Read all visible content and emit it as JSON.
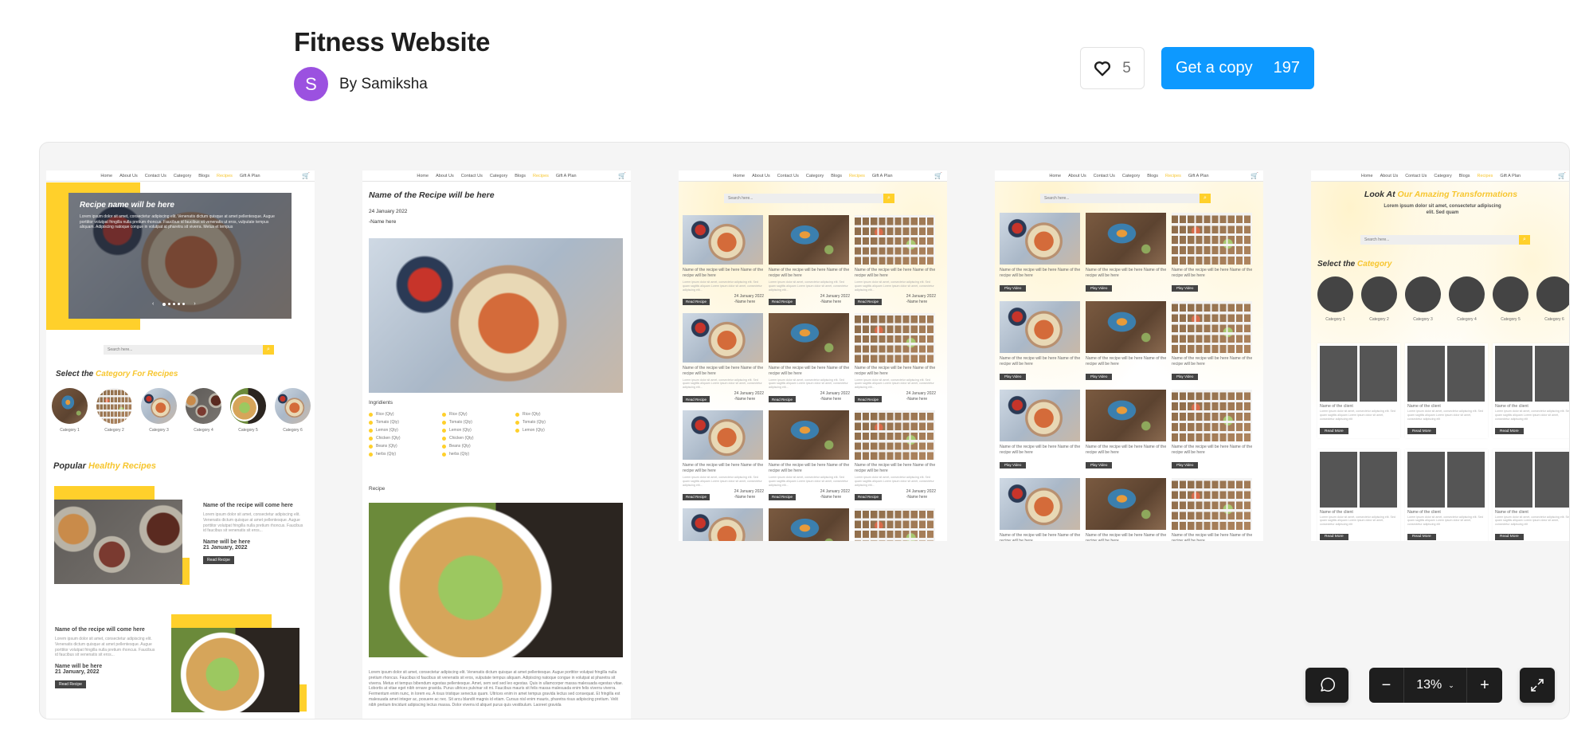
{
  "header": {
    "title": "Fitness Website",
    "author_initial": "S",
    "author_label": "By Samiksha",
    "avatar_color": "#9b51e0",
    "like_count": "5",
    "copy_label": "Get a copy",
    "copy_count": "197",
    "accent_color": "#0d99ff"
  },
  "nav": {
    "items": [
      "Home",
      "About Us",
      "Contact Us",
      "Category",
      "Blogs",
      "Recipes",
      "Gift A Plan"
    ],
    "active": "Recipes"
  },
  "search_placeholder": "Search here...",
  "frame1": {
    "hero_title": "Recipe name will be here",
    "hero_text": "Lorem ipsum dolor sit amet, consectetur adipiscing elit. Venenatis dictum quisque at amet pellentesque. Augue porttitor volutpat fringilla nulla pretium rhoncus. Faucibus id faucibus sit venenatis ut eros, vulputate tempus aliquam. Adipiscing natoque congue in volutpat at pharetra sit viverra. Metus et tempus",
    "category_heading_a": "Select the ",
    "category_heading_b": "Category For Recipes",
    "categories": [
      "Category 1",
      "Category 2",
      "Category 3",
      "Category 4",
      "Category 5",
      "Category 6"
    ],
    "popular_heading_a": "Popular ",
    "popular_heading_b": "Healthy Recipes",
    "popular": [
      {
        "title": "Name of the recipe will come here",
        "text": "Lorem ipsum dolor sit amet, consectetur adipiscing elit. Venenatis dictum quisque at amet pellentesque. Augue porttitor volutpat fringilla nulla pretium rhoncus. Faucibus id faucibus sit venenatis sit eros...",
        "author": "Name will be here",
        "date": "21 January, 2022",
        "button": "Read Recipe"
      },
      {
        "title": "Name of the recipe will come here",
        "text": "Lorem ipsum dolor sit amet, consectetur adipiscing elit. Venenatis dictum quisque at amet pellentesque. Augue porttitor volutpat fringilla nulla pretium rhoncus. Faucibus id faucibus sit venenatis sit eros...",
        "author": "Name will be here",
        "date": "21 January, 2022",
        "button": "Read Recipe"
      }
    ]
  },
  "frame2": {
    "title": "Name of the Recipe will be here",
    "date": "24 January 2022",
    "author": "-Name here",
    "ingredients_heading": "Ingridients",
    "ingredients": [
      [
        "Rice (Qty)",
        "Tomato (Qty)",
        "Lemon (Qty)",
        "Chicken (Qty)",
        "Beans (Qty)",
        "herbs (Qty)"
      ],
      [
        "Rice (Qty)",
        "Tomato (Qty)",
        "Lemon (Qty)",
        "Chicken (Qty)",
        "Beans (Qty)",
        "herbs (Qty)"
      ],
      [
        "Rice (Qty)",
        "Tomato (Qty)",
        "Lemon (Qty)"
      ]
    ],
    "recipe_heading": "Recipe",
    "recipe_text": "Lorem ipsum dolor sit amet, consectetur adipiscing elit. Venenatis dictum quisque at amet pellentesque. Augue porttitor volutpat fringilla nulla pretium rhoncus. Faucibus id faucibus sit venenatis sit eros, vulputate tempus aliquam. Adipiscing natoque congue in volutpat at pharetra sit viverra. Metus et tempus bibendum egestas pellentesque. Amet, sem sed sed leo egestas. Quis in ullamcorper massa malesuada egestas vitae. Lobortis at vitae eget nibh ornare gravida. Purus ultrices pulvinar sit mi. Faucibus mauris sit felis massa malesuada enim felis viverra viverra. Fermentum enim nunc, in lorem eu. A risus tristique senectus quam. Ultrices enim in amet tempus gravida lectus sed consequat. Et fringilla est malesuada amet integer ac, posuere ac nec. Sit arcu blandit magnis id etiam. Cursus nisl enim mauris, pharetra risus adipiscing pretium. Velit nibh pretium tincidunt adipiscing lectus massa. Dolor viverra id aliquet purus quis vestibulum. Laoreet gravida"
  },
  "recipe_card": {
    "title": "Name of the recipe will be here Name of the recipe will be here",
    "text": "Lorem ipsum dolor sit amet, consectetur adipiscing elit. Sed quam sagittis aliquam Lorem ipsum dolor sit amet, consectetur adipiscing elit...",
    "date": "24 January 2022",
    "author": "-Name here",
    "read_button": "Read Recipe",
    "video_button": "Play Video"
  },
  "frame5": {
    "heading_a": "Look At ",
    "heading_b": "Our Amazing Transformations",
    "subtext": "Lorem ipsum dolor sit amet, consectetur adipiscing elit. Sed quam",
    "category_heading_a": "Select the ",
    "category_heading_b": "Category",
    "categories": [
      "Category 1",
      "Category 2",
      "Category 3",
      "Category 4",
      "Category 5",
      "Category 6"
    ],
    "client_name": "Name of the client",
    "client_text": "Lorem ipsum dolor sit amet, consectetur adipiscing elit. Sed quam sagittis aliquam Lorem ipsum dolor sit amet, consectetur adipiscing elit",
    "read_more": "Read More"
  },
  "controls": {
    "zoom_level": "13%",
    "minus": "−",
    "plus": "+"
  }
}
